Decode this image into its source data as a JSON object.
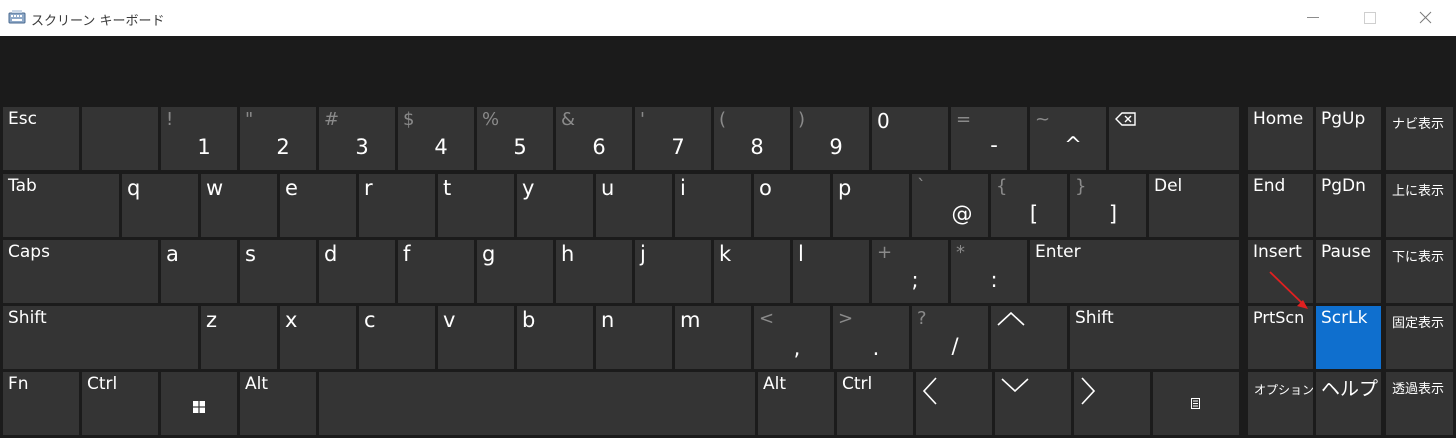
{
  "window": {
    "title": "スクリーン キーボード"
  },
  "rows": {
    "row1": {
      "esc": "Esc",
      "digits": [
        {
          "shift": "!",
          "main": "1"
        },
        {
          "shift": "\"",
          "main": "2"
        },
        {
          "shift": "#",
          "main": "3"
        },
        {
          "shift": "$",
          "main": "4"
        },
        {
          "shift": "%",
          "main": "5"
        },
        {
          "shift": "&",
          "main": "6"
        },
        {
          "shift": "'",
          "main": "7"
        },
        {
          "shift": "(",
          "main": "8"
        },
        {
          "shift": ")",
          "main": "9"
        }
      ],
      "zero": "0",
      "minus": {
        "shift": "=",
        "main": "-"
      },
      "caret": {
        "shift": "~",
        "main": "^"
      }
    },
    "row2": {
      "tab": "Tab",
      "letters": [
        "q",
        "w",
        "e",
        "r",
        "t",
        "y",
        "u",
        "i",
        "o",
        "p"
      ],
      "at": {
        "shift": "`",
        "main": "@"
      },
      "lbracket": {
        "shift": "{",
        "main": "["
      },
      "rbracket": {
        "shift": "}",
        "main": "]"
      },
      "del": "Del"
    },
    "row3": {
      "caps": "Caps",
      "letters": [
        "a",
        "s",
        "d",
        "f",
        "g",
        "h",
        "j",
        "k",
        "l"
      ],
      "semicolon": {
        "shift": "+",
        "main": ";"
      },
      "colon": {
        "shift": "*",
        "main": ":"
      },
      "enter": "Enter"
    },
    "row4": {
      "shift_left": "Shift",
      "letters": [
        "z",
        "x",
        "c",
        "v",
        "b",
        "n",
        "m"
      ],
      "comma": {
        "shift": "<",
        "main": ","
      },
      "period": {
        "shift": ">",
        "main": "."
      },
      "slash": {
        "shift": "?",
        "main": "/"
      },
      "shift_right": "Shift"
    },
    "row5": {
      "fn": "Fn",
      "ctrl_left": "Ctrl",
      "alt_left": "Alt",
      "alt_right": "Alt",
      "ctrl_right": "Ctrl"
    }
  },
  "nav": {
    "home": "Home",
    "pgup": "PgUp",
    "end": "End",
    "pgdn": "PgDn",
    "insert": "Insert",
    "pause": "Pause",
    "prtscn": "PrtScn",
    "scrlk": "ScrLk",
    "options": "オプション",
    "help": "ヘルプ"
  },
  "side": {
    "nav_show": "ナビ表示",
    "up_show": "上に表示",
    "down_show": "下に表示",
    "fixed_show": "固定表示",
    "fade_show": "透過表示"
  },
  "colors": {
    "key": "#343434",
    "active": "#0f6fce",
    "background": "#1b1b1b",
    "arrow": "#e02020"
  },
  "icons": [
    "backspace-icon",
    "windows-icon",
    "menu-icon",
    "arrow-up-icon",
    "arrow-left-icon",
    "arrow-down-icon",
    "arrow-right-icon"
  ]
}
